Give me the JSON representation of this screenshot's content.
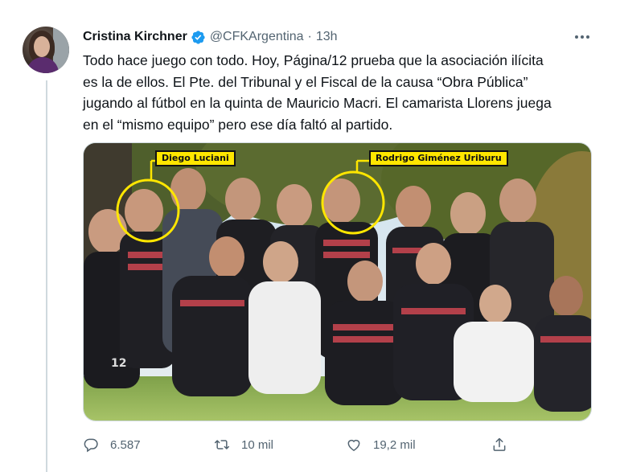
{
  "author": {
    "name": "Cristina Kirchner",
    "handle": "@CFKArgentina",
    "separator": "·",
    "time": "13h",
    "verified_color": "#1d9bf0"
  },
  "tweet": {
    "text": "Todo hace juego con todo. Hoy, Página/12 prueba que la asociación ilícita\nes la de ellos. El Pte. del Tribunal y el Fiscal de la causa “Obra Pública”\njugando al fútbol en la quinta de Mauricio Macri. El camarista Llorens juega\nen el “mismo equipo” pero ese día faltó al partido."
  },
  "photo": {
    "labels": {
      "left": "Diego Luciani",
      "right": "Rodrigo Giménez Uriburu"
    },
    "jersey_number": "12",
    "highlight_color": "#ffe600"
  },
  "actions": {
    "replies": "6.587",
    "retweets": "10 mil",
    "likes": "19,2 mil",
    "icons": [
      "reply-icon",
      "retweet-icon",
      "like-icon",
      "share-icon"
    ]
  },
  "colors": {
    "text": "#0f1419",
    "secondary": "#536471",
    "border": "#cfd9de"
  }
}
